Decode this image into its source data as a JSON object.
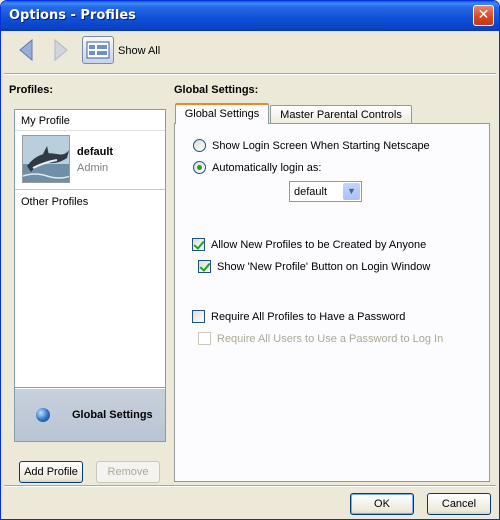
{
  "window": {
    "title": "Options - Profiles",
    "close_glyph": "✕"
  },
  "toolbar": {
    "show_all_label": "Show All"
  },
  "profiles": {
    "heading": "Profiles:",
    "my_profile_label": "My Profile",
    "current": {
      "name": "default",
      "role": "Admin"
    },
    "other_profiles_label": "Other Profiles",
    "global_settings_label": "Global Settings",
    "add_button": "Add Profile",
    "remove_button": "Remove"
  },
  "global": {
    "heading": "Global Settings:",
    "tabs": [
      {
        "label": "Global Settings",
        "active": true
      },
      {
        "label": "Master Parental Controls",
        "active": false
      }
    ],
    "options": {
      "show_login": {
        "label": "Show Login Screen When Starting Netscape",
        "selected": false
      },
      "auto_login": {
        "label": "Automatically login as:",
        "selected": true,
        "value": "default"
      },
      "allow_new_profiles": {
        "label": "Allow New Profiles to be Created by Anyone",
        "checked": true
      },
      "show_new_profile_button": {
        "label": "Show 'New Profile' Button on Login Window",
        "checked": true
      },
      "require_password": {
        "label": "Require All Profiles to Have a Password",
        "checked": false
      },
      "require_users_password": {
        "label": "Require All Users to Use a Password to Log In",
        "checked": false,
        "disabled": true
      }
    }
  },
  "dialog": {
    "ok": "OK",
    "cancel": "Cancel"
  },
  "colors": {
    "accent": "#0a43c6",
    "check": "#21a121",
    "tab_active": "#e68b2c"
  }
}
